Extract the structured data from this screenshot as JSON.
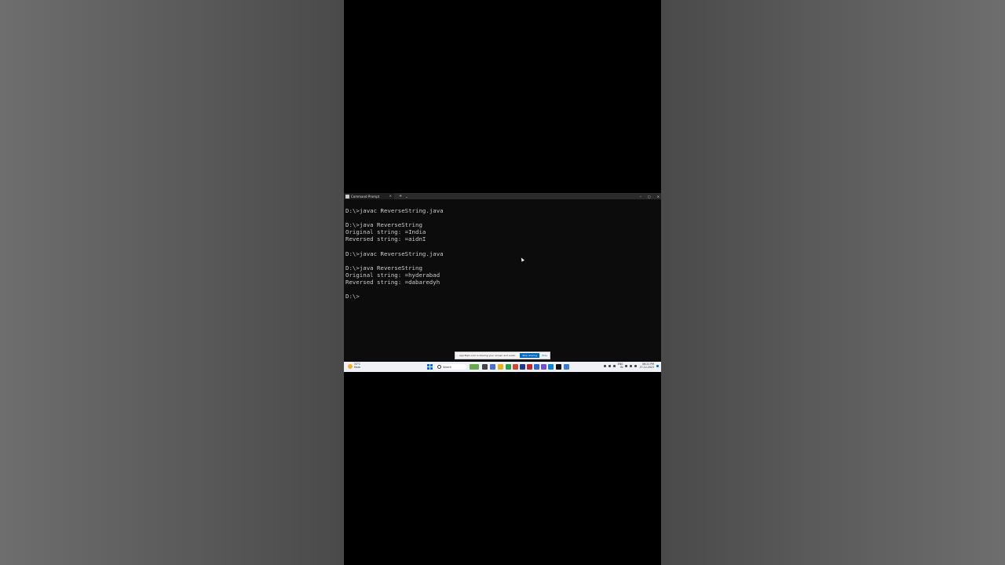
{
  "terminal": {
    "tab_title": "Command Prompt",
    "tab_close": "×",
    "new_tab": "+",
    "tab_dropdown": "⌄",
    "minimize": "–",
    "maximize": "▢",
    "close": "✕",
    "lines": [
      "D:\\>javac ReverseString.java",
      "",
      "D:\\>java ReverseString",
      "Original string: =India",
      "Reversed string: =aidnI",
      "",
      "D:\\>javac ReverseString.java",
      "",
      "D:\\>java ReverseString",
      "Original string: =hyderabad",
      "Reversed string: =dabaredyh",
      "",
      "D:\\>"
    ]
  },
  "share_bar": {
    "grip": "⁞",
    "message": "app.fliqlo.com is sharing your screen and audio.",
    "stop_label": "Stop sharing",
    "hide_label": "Hide"
  },
  "taskbar": {
    "weather_temp": "31°C",
    "weather_desc": "Haze",
    "search_placeholder": "Search",
    "lang": "ENG",
    "lang_sub": "IN",
    "time": "06:21 PM",
    "date": "27-12-2023"
  },
  "colors": {
    "console_bg": "#0c0c0c",
    "console_text": "#cccccc",
    "accent": "#0067c0"
  }
}
